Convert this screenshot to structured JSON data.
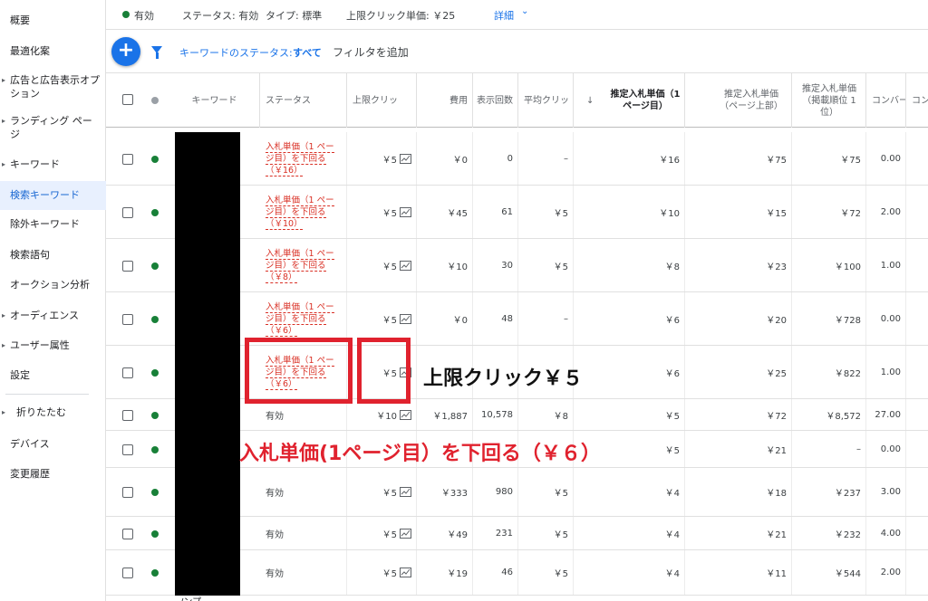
{
  "sidebar": {
    "items": [
      {
        "label": "概要"
      },
      {
        "label": "最適化案"
      },
      {
        "label": "広告と広告表示オプション"
      },
      {
        "label": "ランディング ページ"
      },
      {
        "label": "キーワード"
      },
      {
        "label": "検索キーワード"
      },
      {
        "label": "除外キーワード"
      },
      {
        "label": "検索語句"
      },
      {
        "label": "オークション分析"
      },
      {
        "label": "オーディエンス"
      },
      {
        "label": "ユーザー属性"
      },
      {
        "label": "設定"
      },
      {
        "label": "折りたたむ"
      },
      {
        "label": "デバイス"
      },
      {
        "label": "変更履歴"
      }
    ]
  },
  "topbar": {
    "status_badge": "有効",
    "status": "ステータス: 有効",
    "type": "タイプ: 標準",
    "max_cpc": "上限クリック単価: ￥25",
    "details_link": "詳細"
  },
  "filterbar": {
    "add_button": "+",
    "filter_label": "キーワードのステータス:",
    "filter_value": "すべて",
    "add_filter": "フィルタを追加"
  },
  "table": {
    "headers": {
      "keyword": "キーワード",
      "status": "ステータス",
      "max_cpc": "上限クリッ",
      "cost": "費用",
      "impressions": "表示回数",
      "avg_cpc": "平均クリッ",
      "sort_arrow": "↓",
      "first_page_bid": "推定入札単価（1ページ目）",
      "top_page_bid": "推定入札単価（ページ上部）",
      "first_position_bid": "推定入札単価（掲載順位 1 位）",
      "conversions": "コンバー",
      "more": "コン"
    },
    "rows": [
      {
        "status_lines": [
          "入札単価（1 ペー",
          "ジ目）を下回る",
          "（￥16）"
        ],
        "max_cpc": "￥5",
        "cost": "￥0",
        "impressions": "0",
        "avg_cpc": "–",
        "first_page": "￥16",
        "top_page": "￥75",
        "first_pos": "￥75",
        "conv": "0.00"
      },
      {
        "status_lines": [
          "入札単価（1 ペー",
          "ジ目）を下回る",
          "（￥10）"
        ],
        "max_cpc": "￥5",
        "cost": "￥45",
        "impressions": "61",
        "avg_cpc": "￥5",
        "first_page": "￥10",
        "top_page": "￥15",
        "first_pos": "￥72",
        "conv": "2.00"
      },
      {
        "status_lines": [
          "入札単価（1 ペー",
          "ジ目）を下回る",
          "（￥8）"
        ],
        "max_cpc": "￥5",
        "cost": "￥10",
        "impressions": "30",
        "avg_cpc": "￥5",
        "first_page": "￥8",
        "top_page": "￥23",
        "first_pos": "￥100",
        "conv": "1.00"
      },
      {
        "status_lines": [
          "入札単価（1 ペー",
          "ジ目）を下回る",
          "（￥6）"
        ],
        "max_cpc": "￥5",
        "cost": "￥0",
        "impressions": "48",
        "avg_cpc": "–",
        "first_page": "￥6",
        "top_page": "￥20",
        "first_pos": "￥728",
        "conv": "0.00"
      },
      {
        "status_lines": [
          "入札単価（1 ペー",
          "ジ目）を下回る",
          "（￥6）"
        ],
        "max_cpc": "￥5",
        "cost": "",
        "impressions": "",
        "avg_cpc": "",
        "first_page": "￥6",
        "top_page": "￥25",
        "first_pos": "￥822",
        "conv": "1.00"
      },
      {
        "status": "有効",
        "max_cpc": "￥10",
        "cost": "￥1,887",
        "impressions": "10,578",
        "avg_cpc": "￥8",
        "first_page": "￥5",
        "top_page": "￥72",
        "first_pos": "￥8,572",
        "conv": "27.00"
      },
      {
        "status": "",
        "max_cpc": "",
        "cost": "",
        "impressions": "",
        "avg_cpc": "",
        "first_page": "￥5",
        "top_page": "￥21",
        "first_pos": "–",
        "conv": "0.00"
      },
      {
        "status": "有効",
        "max_cpc": "￥5",
        "cost": "￥333",
        "impressions": "980",
        "avg_cpc": "￥5",
        "first_page": "￥4",
        "top_page": "￥18",
        "first_pos": "￥237",
        "conv": "3.00"
      },
      {
        "status": "有効",
        "max_cpc": "￥5",
        "cost": "￥49",
        "impressions": "231",
        "avg_cpc": "￥5",
        "first_page": "￥4",
        "top_page": "￥21",
        "first_pos": "￥232",
        "conv": "4.00"
      },
      {
        "status": "有効",
        "max_cpc": "￥5",
        "cost": "￥19",
        "impressions": "46",
        "avg_cpc": "￥5",
        "first_page": "￥4",
        "top_page": "￥11",
        "first_pos": "￥544",
        "conv": "2.00"
      }
    ],
    "redacted_footer": "/ンプ"
  },
  "annotations": {
    "callout_cpc": "上限クリック￥５",
    "callout_status": "入札単価(1ページ目）を下回る（￥６）"
  }
}
